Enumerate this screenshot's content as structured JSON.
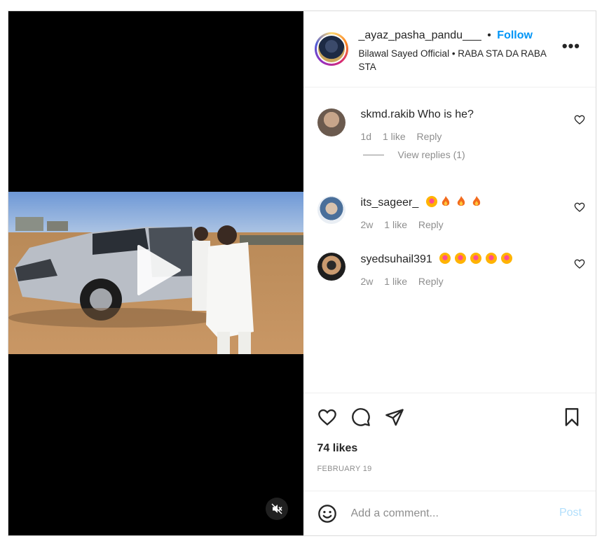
{
  "post": {
    "author": "_ayaz_pasha_pandu___",
    "separator": "•",
    "follow_label": "Follow",
    "subtitle": "Bilawal Sayed Official • RABA STA DA RABA STA",
    "more_label": "•••"
  },
  "comments": [
    {
      "user": "skmd.rakib",
      "text": "Who is he?",
      "time": "1d",
      "likes": "1 like",
      "reply": "Reply"
    },
    {
      "user": "its_sageer_",
      "text": "",
      "time": "2w",
      "likes": "1 like",
      "reply": "Reply",
      "emojis": [
        "heart-eyes",
        "fire",
        "fire",
        "fire"
      ]
    },
    {
      "user": "syedsuhail391",
      "text": "",
      "time": "2w",
      "likes": "1 like",
      "reply": "Reply",
      "emojis": [
        "heart-eyes",
        "heart-eyes",
        "heart-eyes",
        "heart-eyes",
        "heart-eyes"
      ]
    }
  ],
  "view_replies": "View replies (1)",
  "likes": "74 likes",
  "date": "FEBRUARY 19",
  "comment_box": {
    "placeholder": "Add a comment...",
    "post_label": "Post"
  },
  "colors": {
    "accent": "#0095f6",
    "post_disabled": "#b2dffc",
    "muted": "#8e8e8e"
  },
  "icons": [
    "play-icon",
    "mute-icon",
    "more-icon",
    "heart-icon",
    "comment-icon",
    "share-icon",
    "bookmark-icon",
    "emoji-icon"
  ]
}
